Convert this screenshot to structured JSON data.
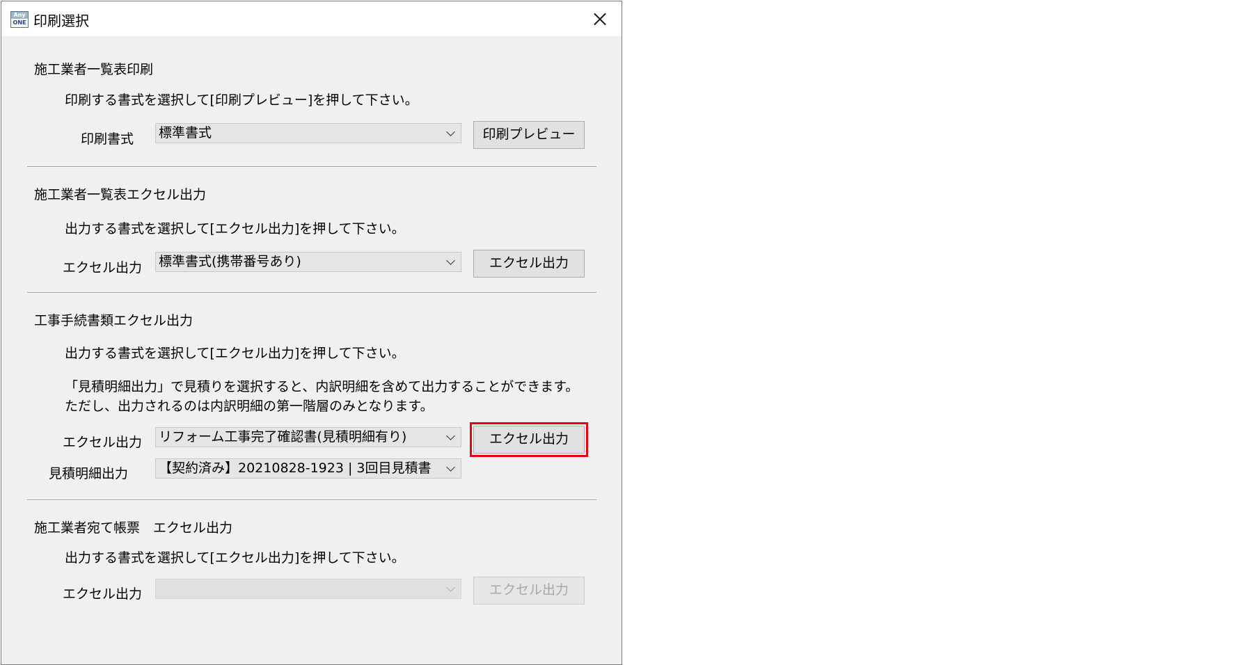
{
  "window": {
    "title": "印刷選択",
    "icon_top": "Any",
    "icon_bottom": "ONE"
  },
  "section1": {
    "heading": "施工業者一覧表印刷",
    "instruction": "印刷する書式を選択して[印刷プレビュー]を押して下さい。",
    "label": "印刷書式",
    "select_value": "標準書式",
    "button": "印刷プレビュー"
  },
  "section2": {
    "heading": "施工業者一覧表エクセル出力",
    "instruction": "出力する書式を選択して[エクセル出力]を押して下さい。",
    "label": "エクセル出力",
    "select_value": "標準書式(携帯番号あり)",
    "button": "エクセル出力"
  },
  "section3": {
    "heading": "工事手続書類エクセル出力",
    "instruction": "出力する書式を選択して[エクセル出力]を押して下さい。",
    "note_line1": "「見積明細出力」で見積りを選択すると、内訳明細を含めて出力することができます。",
    "note_line2": "ただし、出力されるのは内訳明細の第一階層のみとなります。",
    "label": "エクセル出力",
    "select_value": "リフォーム工事完了確認書(見積明細有り)",
    "button": "エクセル出力",
    "estimate_label": "見積明細出力",
    "estimate_value": "【契約済み】20210828-1923 | 3回目見積書"
  },
  "section4": {
    "heading": "施工業者宛て帳票　エクセル出力",
    "instruction": "出力する書式を選択して[エクセル出力]を押して下さい。",
    "label": "エクセル出力",
    "select_value": "",
    "button": "エクセル出力"
  },
  "colors": {
    "highlight": "#e60012",
    "dialog_bg": "#f0f0f0"
  }
}
